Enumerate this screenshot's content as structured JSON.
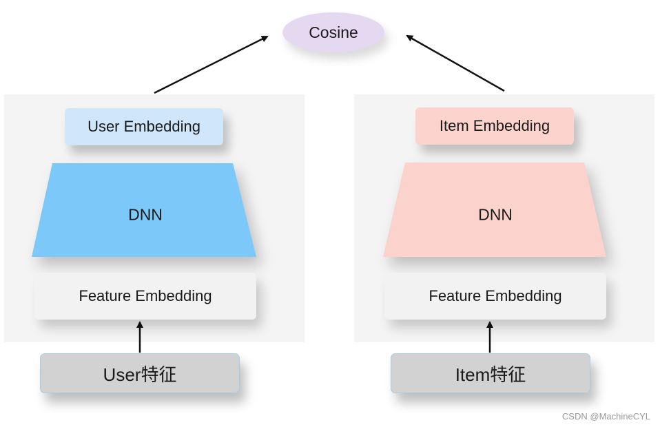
{
  "cosine": {
    "label": "Cosine",
    "color": "#e5d9f1"
  },
  "user_tower": {
    "embedding_label": "User Embedding",
    "dnn_label": "DNN",
    "feature_label": "Feature Embedding",
    "input_label": "User特征",
    "embedding_color": "#cfe6fb",
    "dnn_color": "#7cc8f9"
  },
  "item_tower": {
    "embedding_label": "Item Embedding",
    "dnn_label": "DNN",
    "feature_label": "Feature Embedding",
    "input_label": "Item特征",
    "embedding_color": "#fdd3cd",
    "dnn_color": "#fcd2cc"
  },
  "watermark": "CSDN @MachineCYL"
}
